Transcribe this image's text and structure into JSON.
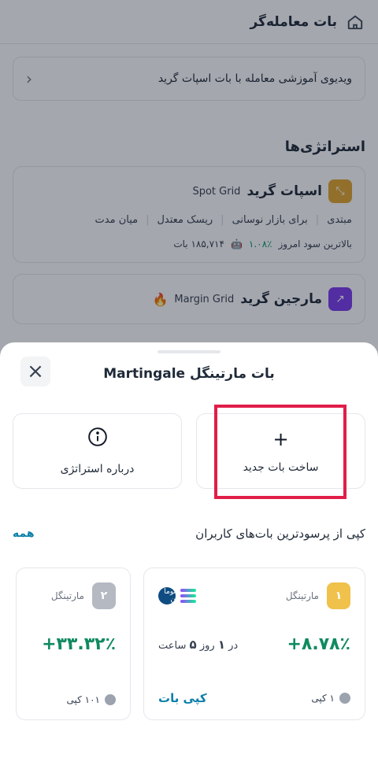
{
  "page": {
    "title": "بات معامله‌گر",
    "video_tutorial": "ویدیوی آموزشی معامله با بات اسپات گرید",
    "strategies_title": "استراتژی‌ها",
    "cards": [
      {
        "title": "اسپات گرید",
        "subtitle": "Spot Grid",
        "tags": [
          "مبتدی",
          "برای بازار نوسانی",
          "ریسک معتدل",
          "میان مدت"
        ],
        "profit_label": "بالاترین سود امروز",
        "profit_pct": "۱.۰۸٪",
        "profit_value": "۱۸۵,۷۱۴ بات",
        "icon": "spot-grid-icon",
        "color": "#e3a72f"
      },
      {
        "title": "مارجین گرید",
        "subtitle": "Margin Grid",
        "icon": "margin-grid-icon",
        "color": "#7c3aed"
      }
    ]
  },
  "sheet": {
    "title": "بات مارتینگل Martingale",
    "actions": {
      "create": "ساخت بات جدید",
      "about": "درباره استراتژی"
    },
    "copy_title": "کپی از پرسودترین بات‌های کاربران",
    "copy_all": "همه",
    "bots": [
      {
        "rank": "۱",
        "strategy": "مارتینگل",
        "pct": "+۸.۷۸٪",
        "duration_prefix": "در",
        "days": "۱",
        "days_label": "روز",
        "hours": "۵",
        "hours_label": "ساعت",
        "copies": "۱ کپی",
        "copy_button": "کپی بات",
        "coin_text": "توما ن"
      },
      {
        "rank": "۲",
        "strategy": "مارتینگل",
        "pct": "+۳۳.۳۲٪",
        "copies": "۱۰۱ کپی"
      }
    ]
  },
  "colors": {
    "accent_link": "#0b7fa8",
    "profit_green": "#0f8a5f",
    "highlight": "#e11d48"
  }
}
